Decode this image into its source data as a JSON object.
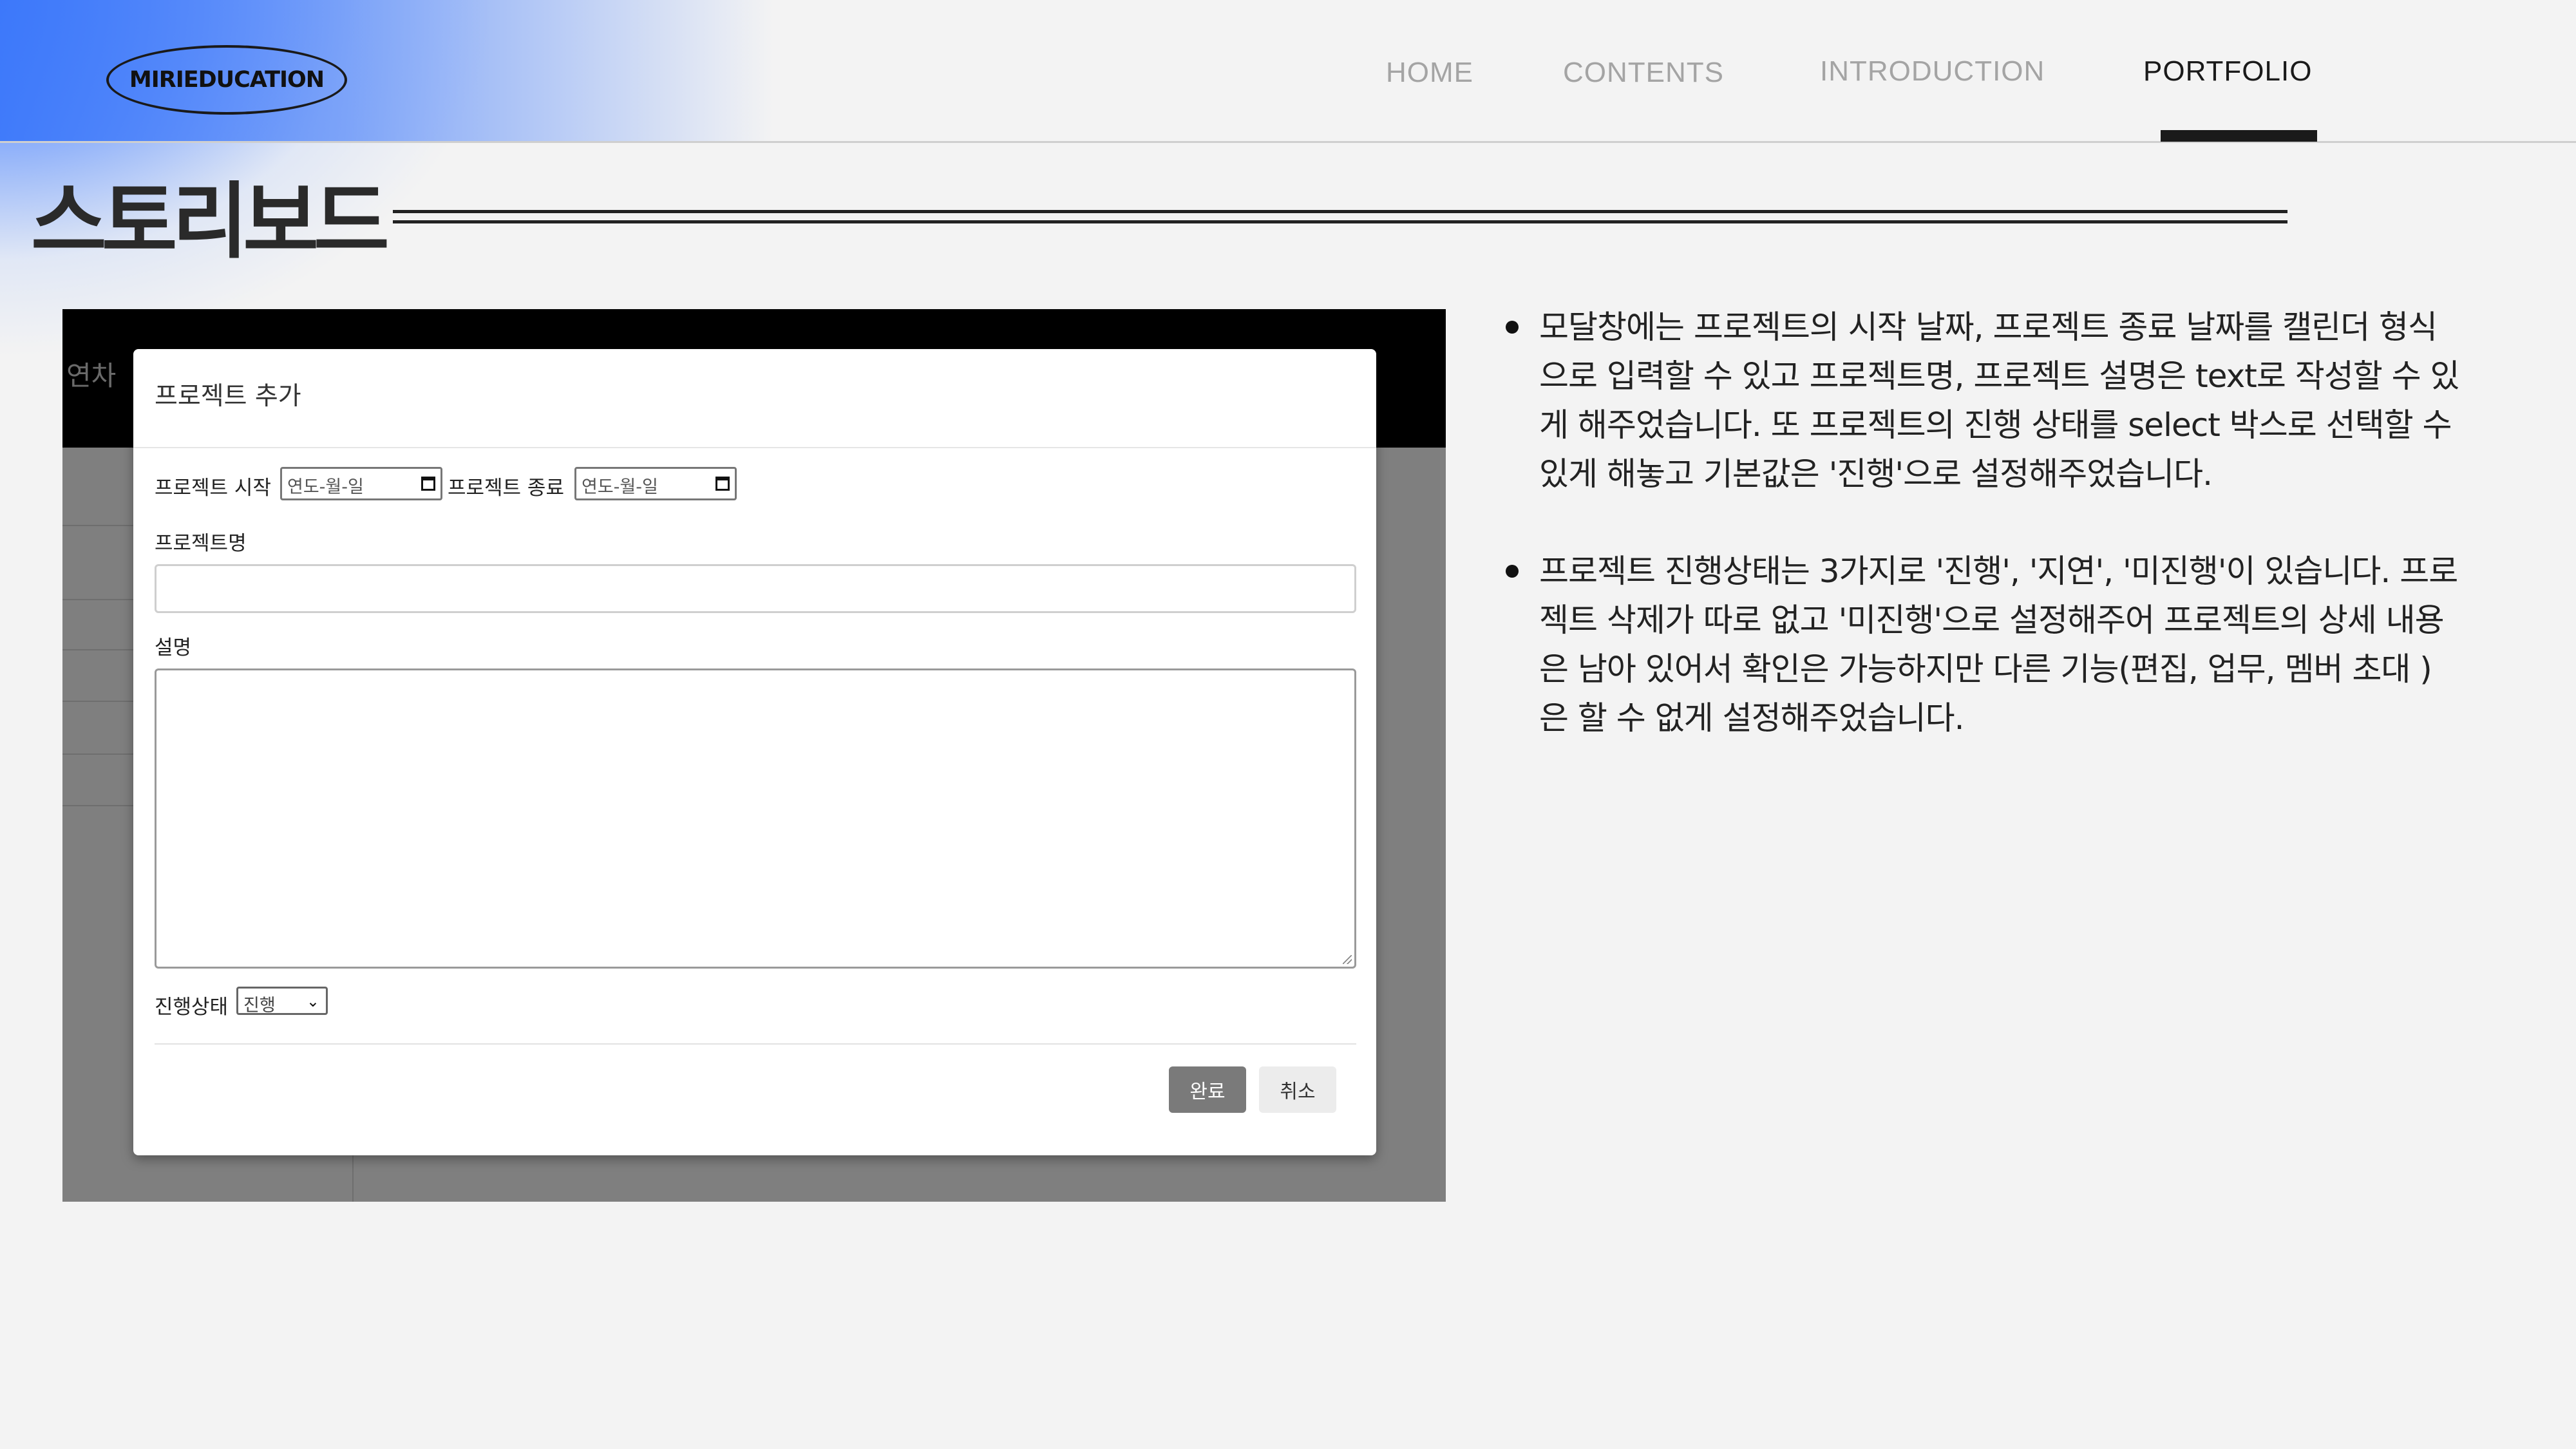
{
  "header": {
    "logo": "MIRIEDUCATION",
    "nav": [
      "HOME",
      "CONTENTS",
      "INTRODUCTION",
      "PORTFOLIO"
    ],
    "active_nav": "PORTFOLIO"
  },
  "page_title": "스토리보드",
  "screenshot": {
    "background_label": "연차",
    "modal": {
      "title": "프로젝트 추가",
      "start_label": "프로젝트 시작",
      "start_placeholder": "연도-월-일",
      "end_label": "프로젝트 종료",
      "end_placeholder": "연도-월-일",
      "name_label": "프로젝트명",
      "name_value": "",
      "desc_label": "설명",
      "desc_value": "",
      "status_label": "진행상태",
      "status_value": "진행",
      "ok_button": "완료",
      "cancel_button": "취소"
    }
  },
  "bullets": [
    "모달창에는 프로젝트의 시작 날짜, 프로젝트 종료 날짜를 캘린더 형식으로 입력할 수 있고 프로젝트명, 프로젝트 설명은 text로 작성할 수 있게 해주었습니다. 또 프로젝트의 진행 상태를 select 박스로 선택할 수 있게 해놓고 기본값은 '진행'으로 설정해주었습니다.",
    "프로젝트 진행상태는 3가지로 '진행', '지연', '미진행'이 있습니다. 프로젝트 삭제가 따로 없고 '미진행'으로 설정해주어 프로젝트의 상세 내용은 남아 있어서 확인은 가능하지만 다른 기능(편집, 업무, 멤버 초대 )은 할 수 없게 설정해주었습니다."
  ]
}
